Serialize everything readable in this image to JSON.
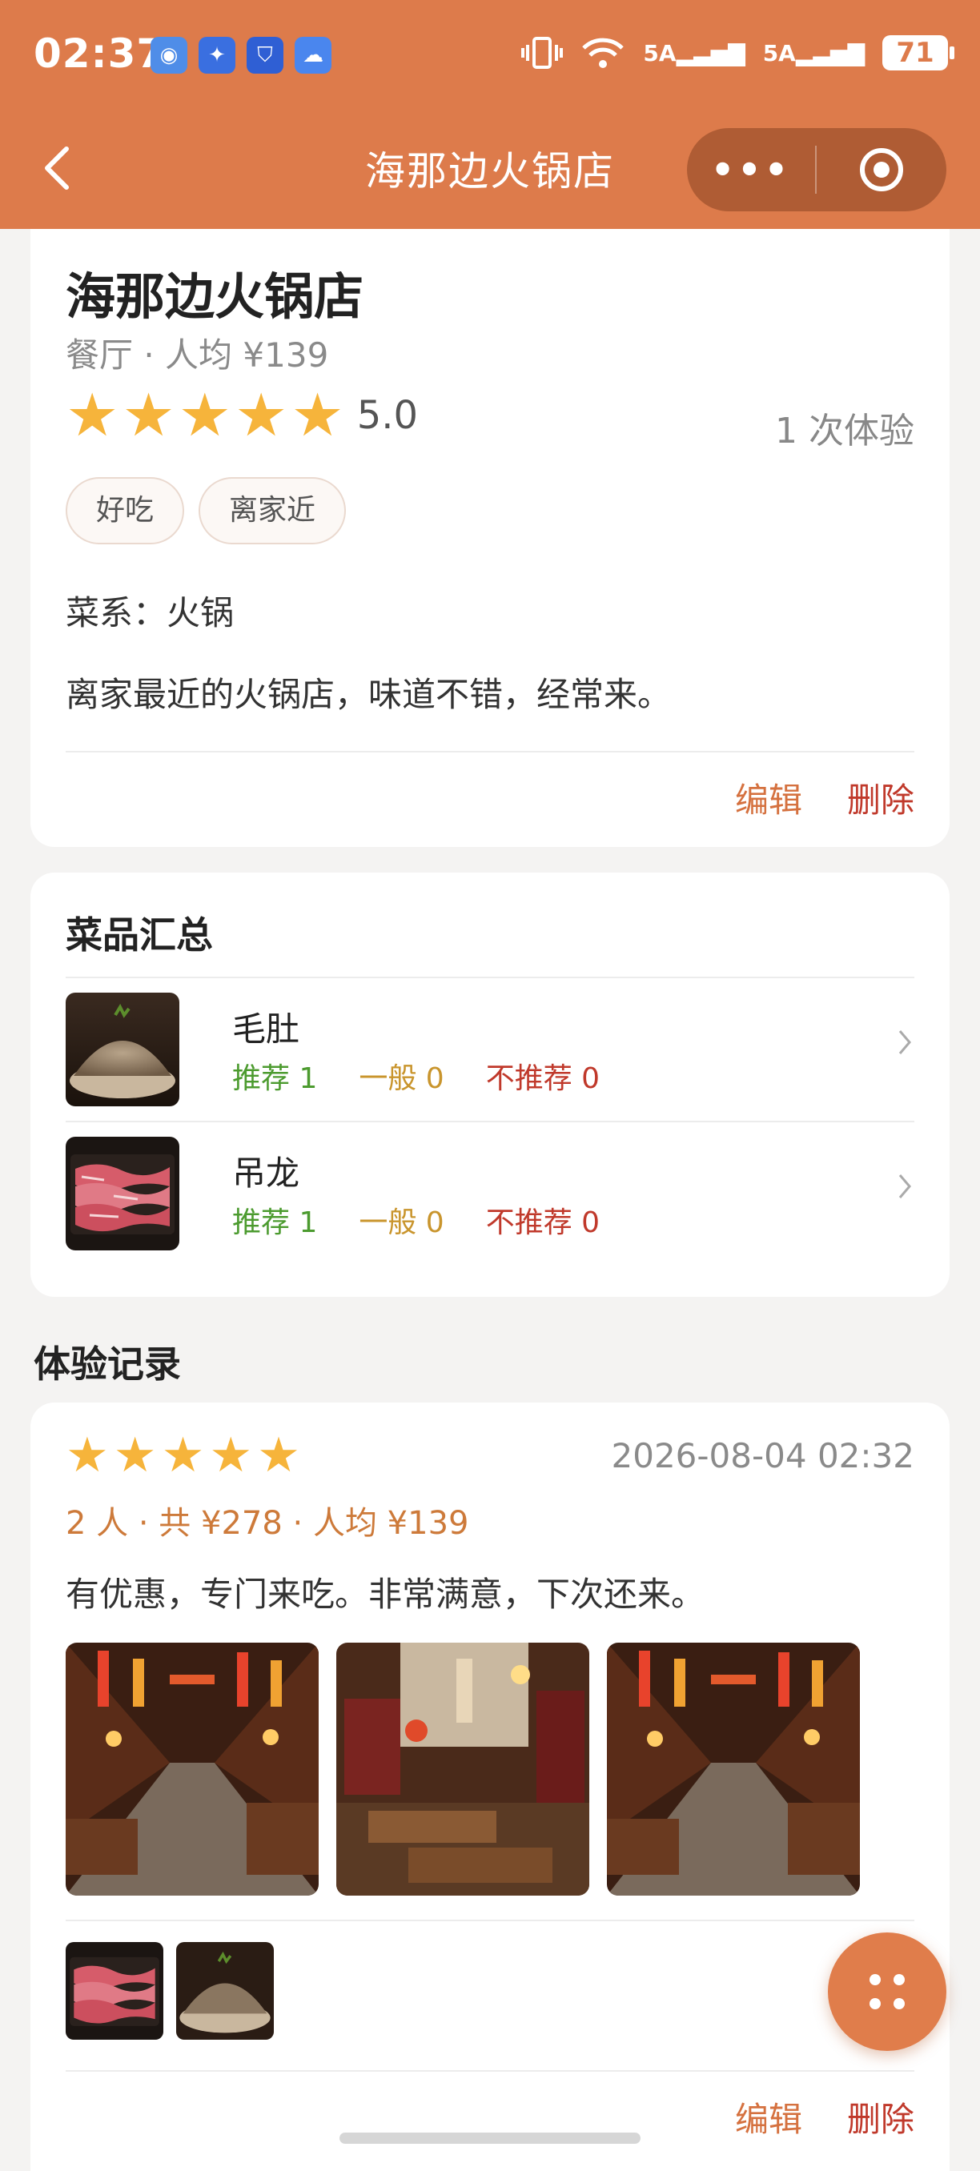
{
  "status_bar": {
    "time": "02:37",
    "network_1": "5A",
    "network_2": "5A",
    "battery": "71",
    "app_icons": [
      "browser-icon",
      "bulb-icon",
      "shield-icon",
      "cloud-icon"
    ]
  },
  "nav": {
    "title": "海那边火锅店",
    "more_label": "•••"
  },
  "shop": {
    "name": "海那边火锅店",
    "meta": "餐厅 · 人均 ¥139",
    "stars": "★★★★★",
    "rating": "5.0",
    "visit_count": "1 次体验",
    "tags": [
      "好吃",
      "离家近"
    ],
    "cuisine": "菜系：火锅",
    "description": "离家最近的火锅店，味道不错，经常来。",
    "edit_label": "编辑",
    "delete_label": "删除"
  },
  "dishes": {
    "title": "菜品汇总",
    "items": [
      {
        "name": "毛肚",
        "recommend": "推荐 1",
        "neutral": "一般 0",
        "not_recommend": "不推荐 0"
      },
      {
        "name": "吊龙",
        "recommend": "推荐 1",
        "neutral": "一般 0",
        "not_recommend": "不推荐 0"
      }
    ]
  },
  "records": {
    "title": "体验记录",
    "items": [
      {
        "stars": "★★★★★",
        "date": "2026-08-04 02:32",
        "meta": "2 人 · 共 ¥278 · 人均 ¥139",
        "text": "有优惠，专门来吃。非常满意，下次还来。",
        "edit_label": "编辑",
        "delete_label": "删除"
      }
    ]
  },
  "colors": {
    "header": "#dd7b4b",
    "star": "#f6b43b",
    "recommend": "#4c9b2f",
    "neutral": "#c9952d",
    "not_recommend": "#c0392b",
    "accent": "#d5713f"
  }
}
